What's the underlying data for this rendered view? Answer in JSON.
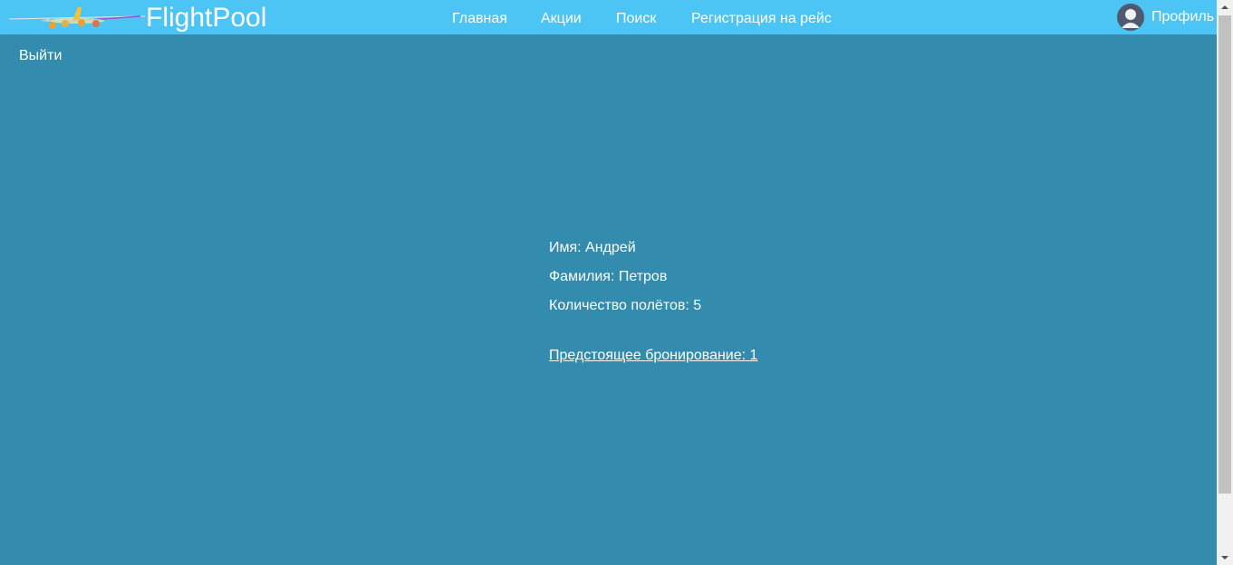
{
  "header": {
    "brand": "FlightPool",
    "nav": [
      {
        "label": "Главная"
      },
      {
        "label": "Акции"
      },
      {
        "label": "Поиск"
      },
      {
        "label": "Регистрация на рейс"
      }
    ],
    "profile_label": "Профиль"
  },
  "logout_label": "Выйти",
  "profile_info": {
    "first_name_line": "Имя: Андрей",
    "last_name_line": "Фамилия: Петров",
    "flights_line": "Количество полётов: 5",
    "booking_link": "Предстоящее бронирование: 1"
  },
  "colors": {
    "header_bg": "#4cc5f5",
    "page_bg": "#338bad",
    "text": "#ffffff"
  },
  "icons": {
    "logo": "airplane-logo-icon",
    "avatar": "user-avatar-icon"
  }
}
